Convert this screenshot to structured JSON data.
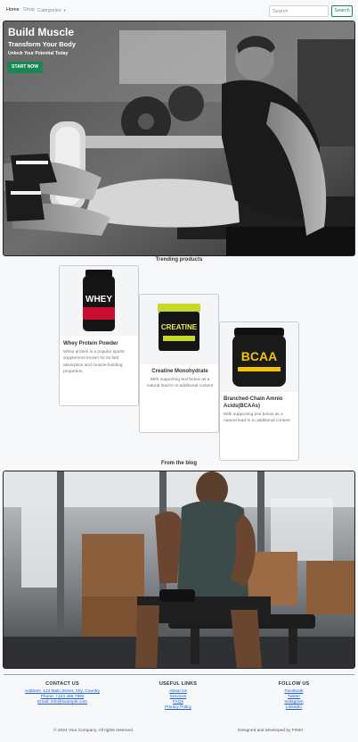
{
  "nav": {
    "links": [
      "Home",
      "Shop",
      "Categories"
    ],
    "search_placeholder": "Search",
    "search_button": "Search"
  },
  "hero": {
    "title": "Build Muscle",
    "subtitle": "Transform Your Body",
    "tagline": "Unlock Your Potential Today",
    "cta": "START NOW"
  },
  "trending": {
    "heading": "Trending products",
    "products": [
      {
        "title": "Whey Protein Powder",
        "text": "Whey protein is a popular sports supplement known for its fast absorption and muscle-building properties.",
        "image_label": "WHEY",
        "accent": "#c8102e"
      },
      {
        "title": "Creatine Monohydrate",
        "text": "With supporting text below as a natural lead-in to additional content",
        "image_label": "CREATINE",
        "accent": "#c6d92b"
      },
      {
        "title": "Branched-Chain Amnio Acids(BCAAs)",
        "text": "With supporting text below as a natural lead-in to additional content",
        "image_label": "BCAA",
        "accent": "#f2c500"
      }
    ]
  },
  "blog": {
    "heading": "From the blog"
  },
  "footer": {
    "contact": {
      "heading": "CONTACT US",
      "lines": [
        "Address: 123 Main Street, City, Country",
        "Phone: +123 456 7890",
        "Email: info@example.com"
      ]
    },
    "useful": {
      "heading": "USEFUL LINKS",
      "links": [
        "About Us",
        "Services",
        "FAQs",
        "Privacy Policy"
      ]
    },
    "follow": {
      "heading": "FOLLOW US",
      "links": [
        "Facebook",
        "Twitter",
        "Instagram",
        "LinkedIn"
      ]
    },
    "copyright": "© 2024 Your Company. All rights reserved.",
    "credits": "Designed and developed by FINKI"
  },
  "colors": {
    "brand_green": "#198754",
    "link_blue": "#1a5dd6"
  }
}
